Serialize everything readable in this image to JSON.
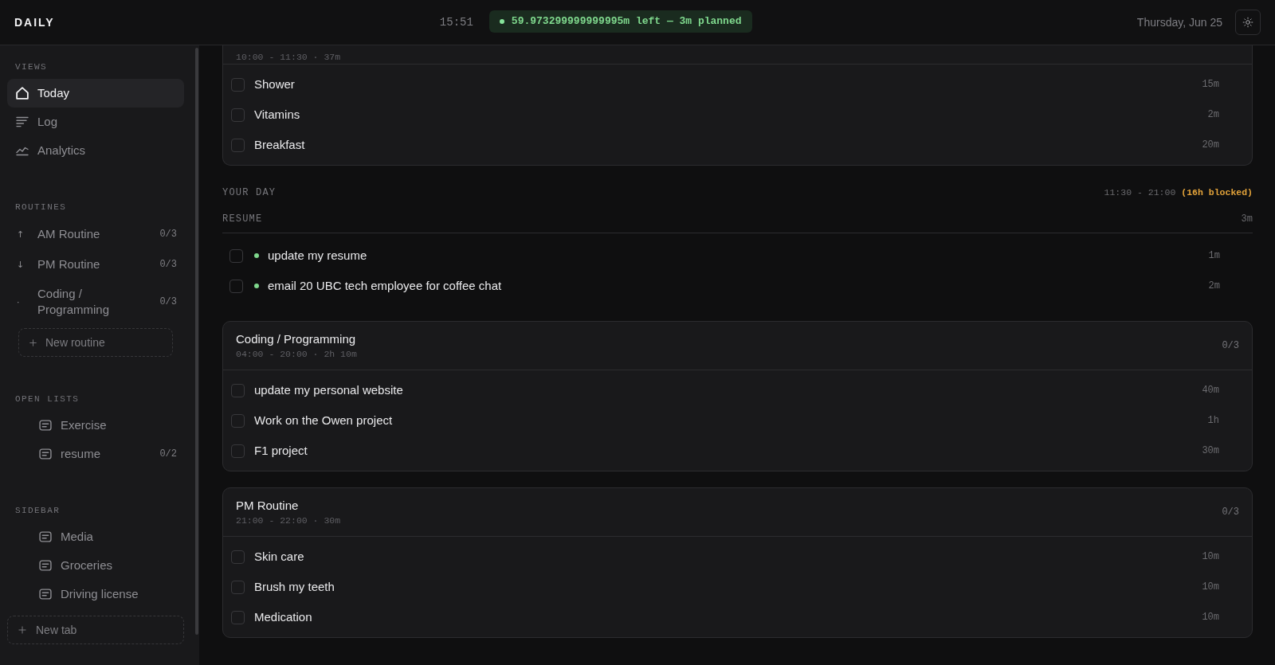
{
  "top_bar": {
    "logo": "DAILY",
    "clock": "15:51",
    "time_left": "59.973299999999995m left — 3m planned",
    "date": "Thursday, Jun 25"
  },
  "sidebar": {
    "sections": [
      {
        "kind": "views",
        "title": "VIEWS",
        "items": [
          {
            "kind": "home",
            "label": "Today",
            "selected": true
          },
          {
            "kind": "log",
            "label": "Log",
            "selected": false
          },
          {
            "kind": "chart",
            "label": "Analytics",
            "selected": false
          }
        ]
      },
      {
        "kind": "routines",
        "title": "ROUTINES",
        "items": [
          {
            "marker": "↑",
            "label": "AM Routine",
            "count": "0/3",
            "selected": false
          },
          {
            "marker": "↓",
            "label": "PM Routine",
            "count": "0/3",
            "selected": false
          },
          {
            "marker": "·",
            "label": "Coding / Programming",
            "count": "0/3",
            "selected": false
          }
        ],
        "add_button": "New routine"
      },
      {
        "kind": "lists",
        "title": "OPEN LISTS",
        "items": [
          {
            "label": "Exercise",
            "selected": false
          },
          {
            "label": "resume",
            "count": "0/2",
            "selected": false
          }
        ]
      },
      {
        "kind": "lists",
        "title": "SIDEBAR",
        "items": [
          {
            "label": "Media",
            "selected": false
          },
          {
            "label": "Groceries",
            "selected": false
          },
          {
            "label": "Driving license",
            "selected": false
          }
        ]
      }
    ],
    "new_tab": "New tab"
  },
  "main": {
    "clipped_routine": {
      "meta": "10:00 - 11:30 · 37m",
      "tasks": [
        {
          "label": "Shower",
          "duration": "15m",
          "checked": false
        },
        {
          "label": "Vitamins",
          "duration": "2m",
          "checked": false
        },
        {
          "label": "Breakfast",
          "duration": "20m",
          "checked": false
        }
      ]
    },
    "your_day": {
      "title": "YOUR DAY",
      "range": "11:30 - 21:00",
      "blocked": "(16h blocked)"
    },
    "groups": [
      {
        "title": "RESUME",
        "total": "3m",
        "tasks": [
          {
            "label": "update my resume",
            "duration": "1m",
            "color": "#7fd88d",
            "checked": false
          },
          {
            "label": "email 20 UBC tech employee for coffee chat",
            "duration": "2m",
            "color": "#7fd88d",
            "checked": false
          }
        ]
      }
    ],
    "routines": [
      {
        "title": "Coding / Programming",
        "meta": "04:00 - 20:00 · 2h 10m",
        "count": "0/3",
        "tasks": [
          {
            "label": "update my personal website",
            "duration": "40m",
            "checked": false
          },
          {
            "label": "Work on the Owen project",
            "duration": "1h",
            "checked": false
          },
          {
            "label": "F1 project",
            "duration": "30m",
            "checked": false
          }
        ]
      },
      {
        "title": "PM Routine",
        "meta": "21:00 - 22:00 · 30m",
        "count": "0/3",
        "tasks": [
          {
            "label": "Skin care",
            "duration": "10m",
            "checked": false
          },
          {
            "label": "Brush my teeth",
            "duration": "10m",
            "checked": false
          },
          {
            "label": "Medication",
            "duration": "10m",
            "checked": false
          }
        ]
      }
    ]
  }
}
